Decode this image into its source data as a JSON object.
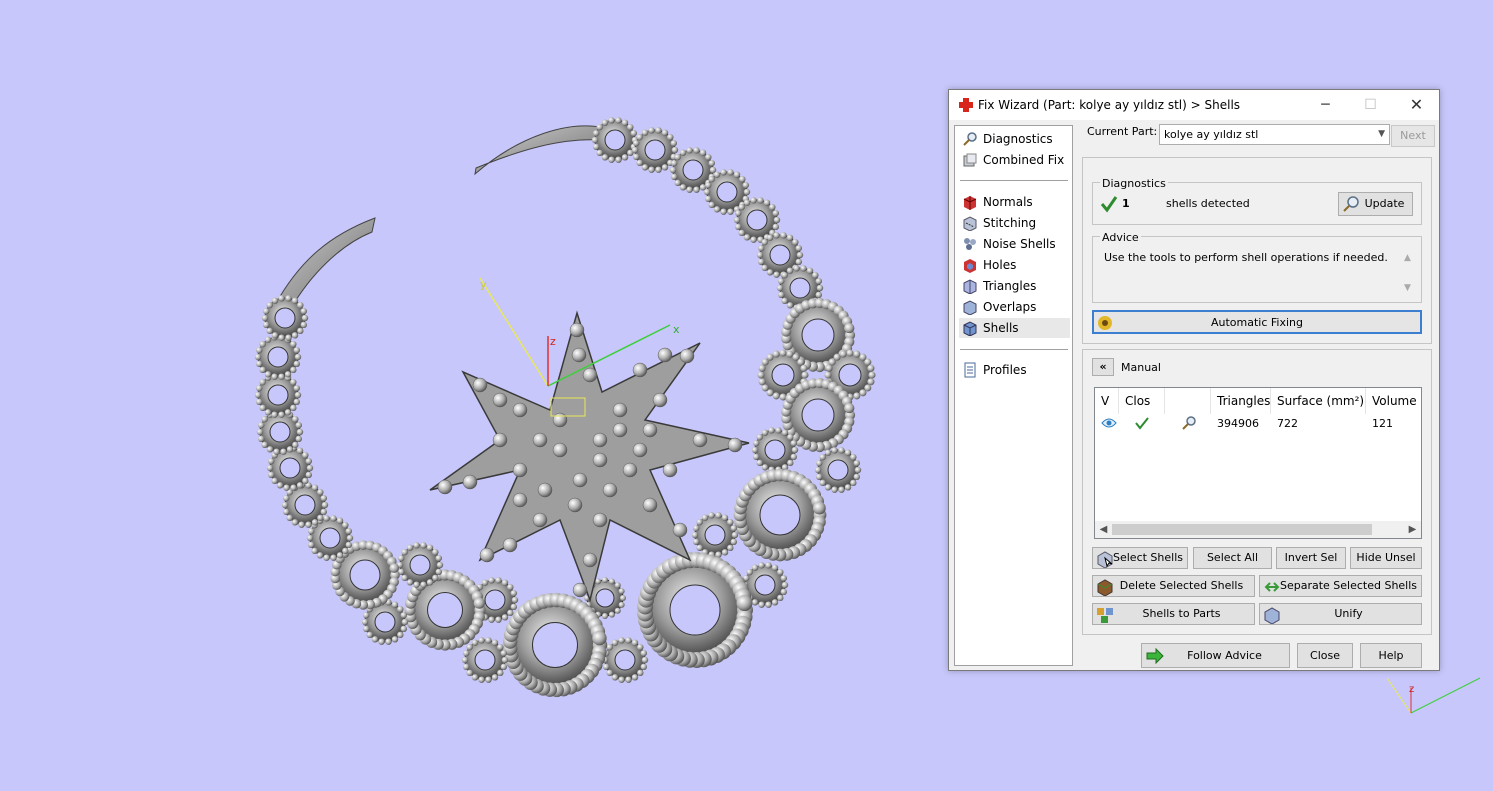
{
  "viewport": {
    "axes_main": {
      "x_label": "x",
      "y_label": "y",
      "z_label": "z"
    },
    "axes_corner": {
      "z_label": "z"
    }
  },
  "dialog": {
    "title": "Fix Wizard (Part: kolye ay yıldız stl) > Shells",
    "window_controls": {
      "minimize": "─",
      "maximize": "☐",
      "close": "✕"
    }
  },
  "nav": {
    "items_top": [
      {
        "label": "Diagnostics",
        "icon": "magnifier-icon"
      },
      {
        "label": "Combined Fix",
        "icon": "combined-fix-icon"
      }
    ],
    "items_tools": [
      {
        "label": "Normals",
        "icon": "normals-icon"
      },
      {
        "label": "Stitching",
        "icon": "stitching-icon"
      },
      {
        "label": "Noise Shells",
        "icon": "noise-shells-icon"
      },
      {
        "label": "Holes",
        "icon": "holes-icon"
      },
      {
        "label": "Triangles",
        "icon": "triangles-icon"
      },
      {
        "label": "Overlaps",
        "icon": "overlaps-icon"
      },
      {
        "label": "Shells",
        "icon": "shells-icon",
        "selected": true
      }
    ],
    "items_bottom": [
      {
        "label": "Profiles",
        "icon": "profiles-icon"
      }
    ]
  },
  "current_part": {
    "label": "Current Part:",
    "value": "kolye ay yıldız stl",
    "next_label": "Next"
  },
  "diagnostics": {
    "title": "Diagnostics",
    "count": "1",
    "status_text": "shells detected",
    "update_label": "Update",
    "status_color": "#2e8b2e"
  },
  "advice": {
    "title": "Advice",
    "text": "Use the tools to perform shell operations if needed.",
    "auto_fix_label": "Automatic Fixing"
  },
  "manual": {
    "title": "Manual",
    "collapse_glyph": "«",
    "columns": [
      "V",
      "Clos",
      "",
      "Triangles",
      "Surface (mm²)",
      "Volume ("
    ],
    "rows": [
      {
        "visible": "eye-icon",
        "closed": "check-icon",
        "tool": "magnifier-icon",
        "triangles": "394906",
        "surface": "722",
        "volume": "121"
      }
    ],
    "buttons_row1": [
      "Select Shells",
      "Select All",
      "Invert Sel",
      "Hide Unsel"
    ],
    "delete_label": "Delete Selected Shells",
    "separate_label": "Separate Selected Shells",
    "shells_to_parts_label": "Shells to Parts",
    "unify_label": "Unify"
  },
  "footer": {
    "follow_advice_label": "Follow Advice",
    "close_label": "Close",
    "help_label": "Help"
  }
}
